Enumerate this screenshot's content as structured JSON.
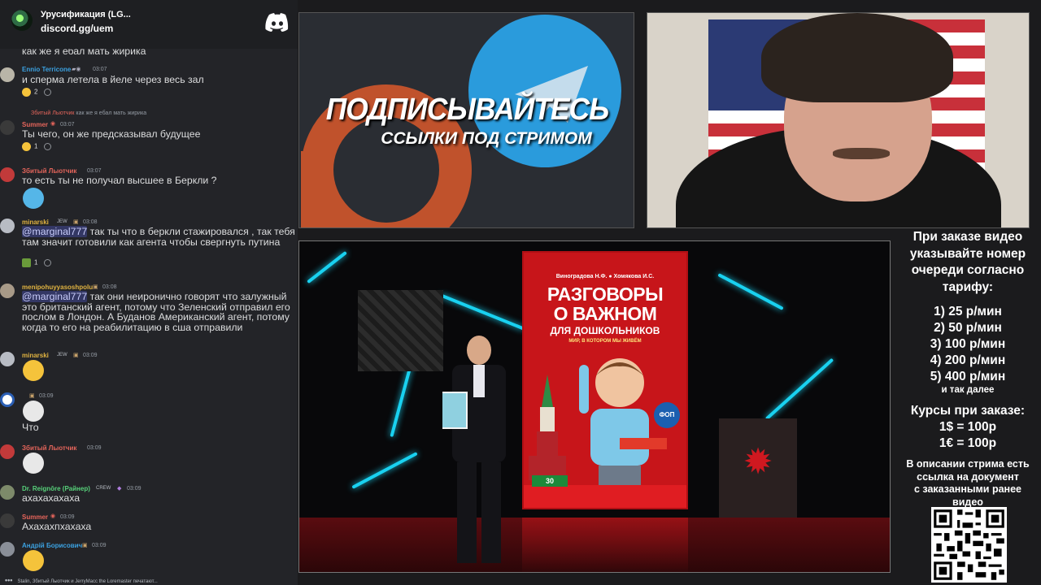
{
  "server": {
    "name": "Урусификация (LG...",
    "invite": "discord.gg/uem"
  },
  "chat": {
    "partial_top": "как же я ебал мать жирика",
    "messages": [
      {
        "author": "Ennio Terricone",
        "author_color": "#3ba1e0",
        "time": "03:07",
        "text": "и сперма летела в йеле через весь зал",
        "reaction_count": "2"
      },
      {
        "reply_author": "Збитый Лыотчик",
        "reply_text": "как же я ебал мать жирика",
        "author": "Summer",
        "author_color": "#e5655b",
        "time": "03:07",
        "text": "Ты чего, он же предсказывал будущее",
        "reaction_count": "1"
      },
      {
        "author": "Збитый Лыотчик",
        "author_color": "#e5655b",
        "time": "03:07",
        "text": "то есть ты не получал высшее в Беркли ?"
      },
      {
        "author": "minarski",
        "author_color": "#e0b341",
        "tag": "JEW",
        "time": "03:08",
        "mention": "@marginal777",
        "text": " так ты что в беркли стажировался , так тебя там значит готовили как агента чтобы свергнуть путина",
        "reaction_count": "1"
      },
      {
        "author": "menipohuyyasoshpolu",
        "author_color": "#e0b341",
        "time": "03:08",
        "mention": "@marginal777",
        "text": " так они неиронично говорят что залужный это британский агент, потому что Зеленский отправил его послом в Лондон. А Буданов Американский агент, потому когда то его на реабилитацию в сша отправили"
      },
      {
        "author": "minarski",
        "author_color": "#e0b341",
        "tag": "JEW",
        "time": "03:09"
      },
      {
        "author": "",
        "author_color": "#ffffff",
        "time": "03:09",
        "text": "Что"
      },
      {
        "author": "Збитый Лыотчик",
        "author_color": "#e5655b",
        "time": "03:09"
      },
      {
        "author": "Dr. Reignōre (Райнер)",
        "author_color": "#57d17a",
        "tag": "CREW",
        "time": "03:09",
        "text": "ахахахахаха"
      },
      {
        "author": "Summer",
        "author_color": "#e5655b",
        "time": "03:09",
        "text": "Ахахахпхахаха"
      },
      {
        "author": "Андрій Борисович",
        "author_color": "#3ba1e0",
        "time": "03:09"
      }
    ],
    "typing": "Stalin, Збитый Лыотчик и JerryMacc the Loremaster печатают..."
  },
  "banner": {
    "title": "ПОДПИСЫВАЙТЕСЬ",
    "subtitle": "ССЫЛКИ ПОД СТРИМОМ",
    "colors": {
      "patreon": "#c0522c",
      "telegram": "#2a9bdc"
    }
  },
  "video": {
    "book_authors": "Виноградова Н.Ф.  ●  Хомякова И.С.",
    "book_title_1": "РАЗГОВОРЫ",
    "book_title_2": "О ВАЖНОМ",
    "book_title_3": "ДЛЯ ДОШКОЛЬНИКОВ",
    "book_subtitle": "МИР, В КОТОРОМ МЫ ЖИВЁМ",
    "book_badge": "30",
    "book_fop": "ФОП"
  },
  "prices": {
    "heading": [
      "При заказе видео",
      "указывайте номер",
      "очереди согласно",
      "тарифу:"
    ],
    "tariffs": [
      "1) 25 р/мин",
      "2) 50 р/мин",
      "3) 100 р/мин",
      "4) 200 р/мин",
      "5) 400 р/мин"
    ],
    "etc": "и так далее",
    "rates_title": "Курсы при заказе:",
    "rates": [
      "1$ = 100р",
      "1€ = 100р"
    ],
    "note": [
      "В описании стрима есть",
      "ссылка на документ",
      "с заказанными ранее",
      "видео"
    ]
  }
}
